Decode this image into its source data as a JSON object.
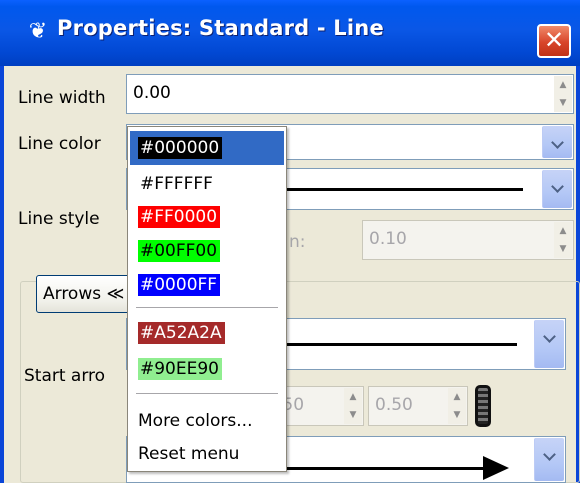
{
  "window": {
    "title": "Properties: Standard - Line",
    "close_glyph": "✕",
    "app_icon": "palette-icon"
  },
  "form": {
    "line_width": {
      "label": "Line width",
      "value": "0.00"
    },
    "line_color": {
      "label": "Line color"
    },
    "line_style": {
      "label": "Line style",
      "partial_label": "n:",
      "value": "0.10"
    },
    "arrows": {
      "button_label": "Arrows ≪",
      "start_label": "Start arro",
      "start_spin1": ".50",
      "start_spin2": "0.50"
    }
  },
  "color_menu": {
    "items": [
      {
        "label": "#000000",
        "bg": "#000000",
        "fg": "#ffffff",
        "selected": true
      },
      {
        "label": "#FFFFFF",
        "bg": "#ffffff",
        "fg": "#000000"
      },
      {
        "label": "#FF0000",
        "bg": "#ff0000",
        "fg": "#ffffff"
      },
      {
        "label": "#00FF00",
        "bg": "#00ff00",
        "fg": "#000000"
      },
      {
        "label": "#0000FF",
        "bg": "#0000ff",
        "fg": "#ffffff"
      },
      {
        "label": "#A52A2A",
        "bg": "#a52a2a",
        "fg": "#ffffff"
      },
      {
        "label": "#90EE90",
        "bg": "#90ee90",
        "fg": "#000000"
      }
    ],
    "more_colors": "More colors...",
    "reset_menu": "Reset menu"
  },
  "colors": {
    "titlebar": "#0058ee",
    "client_bg": "#ece9d8",
    "selection": "#316ac5"
  }
}
